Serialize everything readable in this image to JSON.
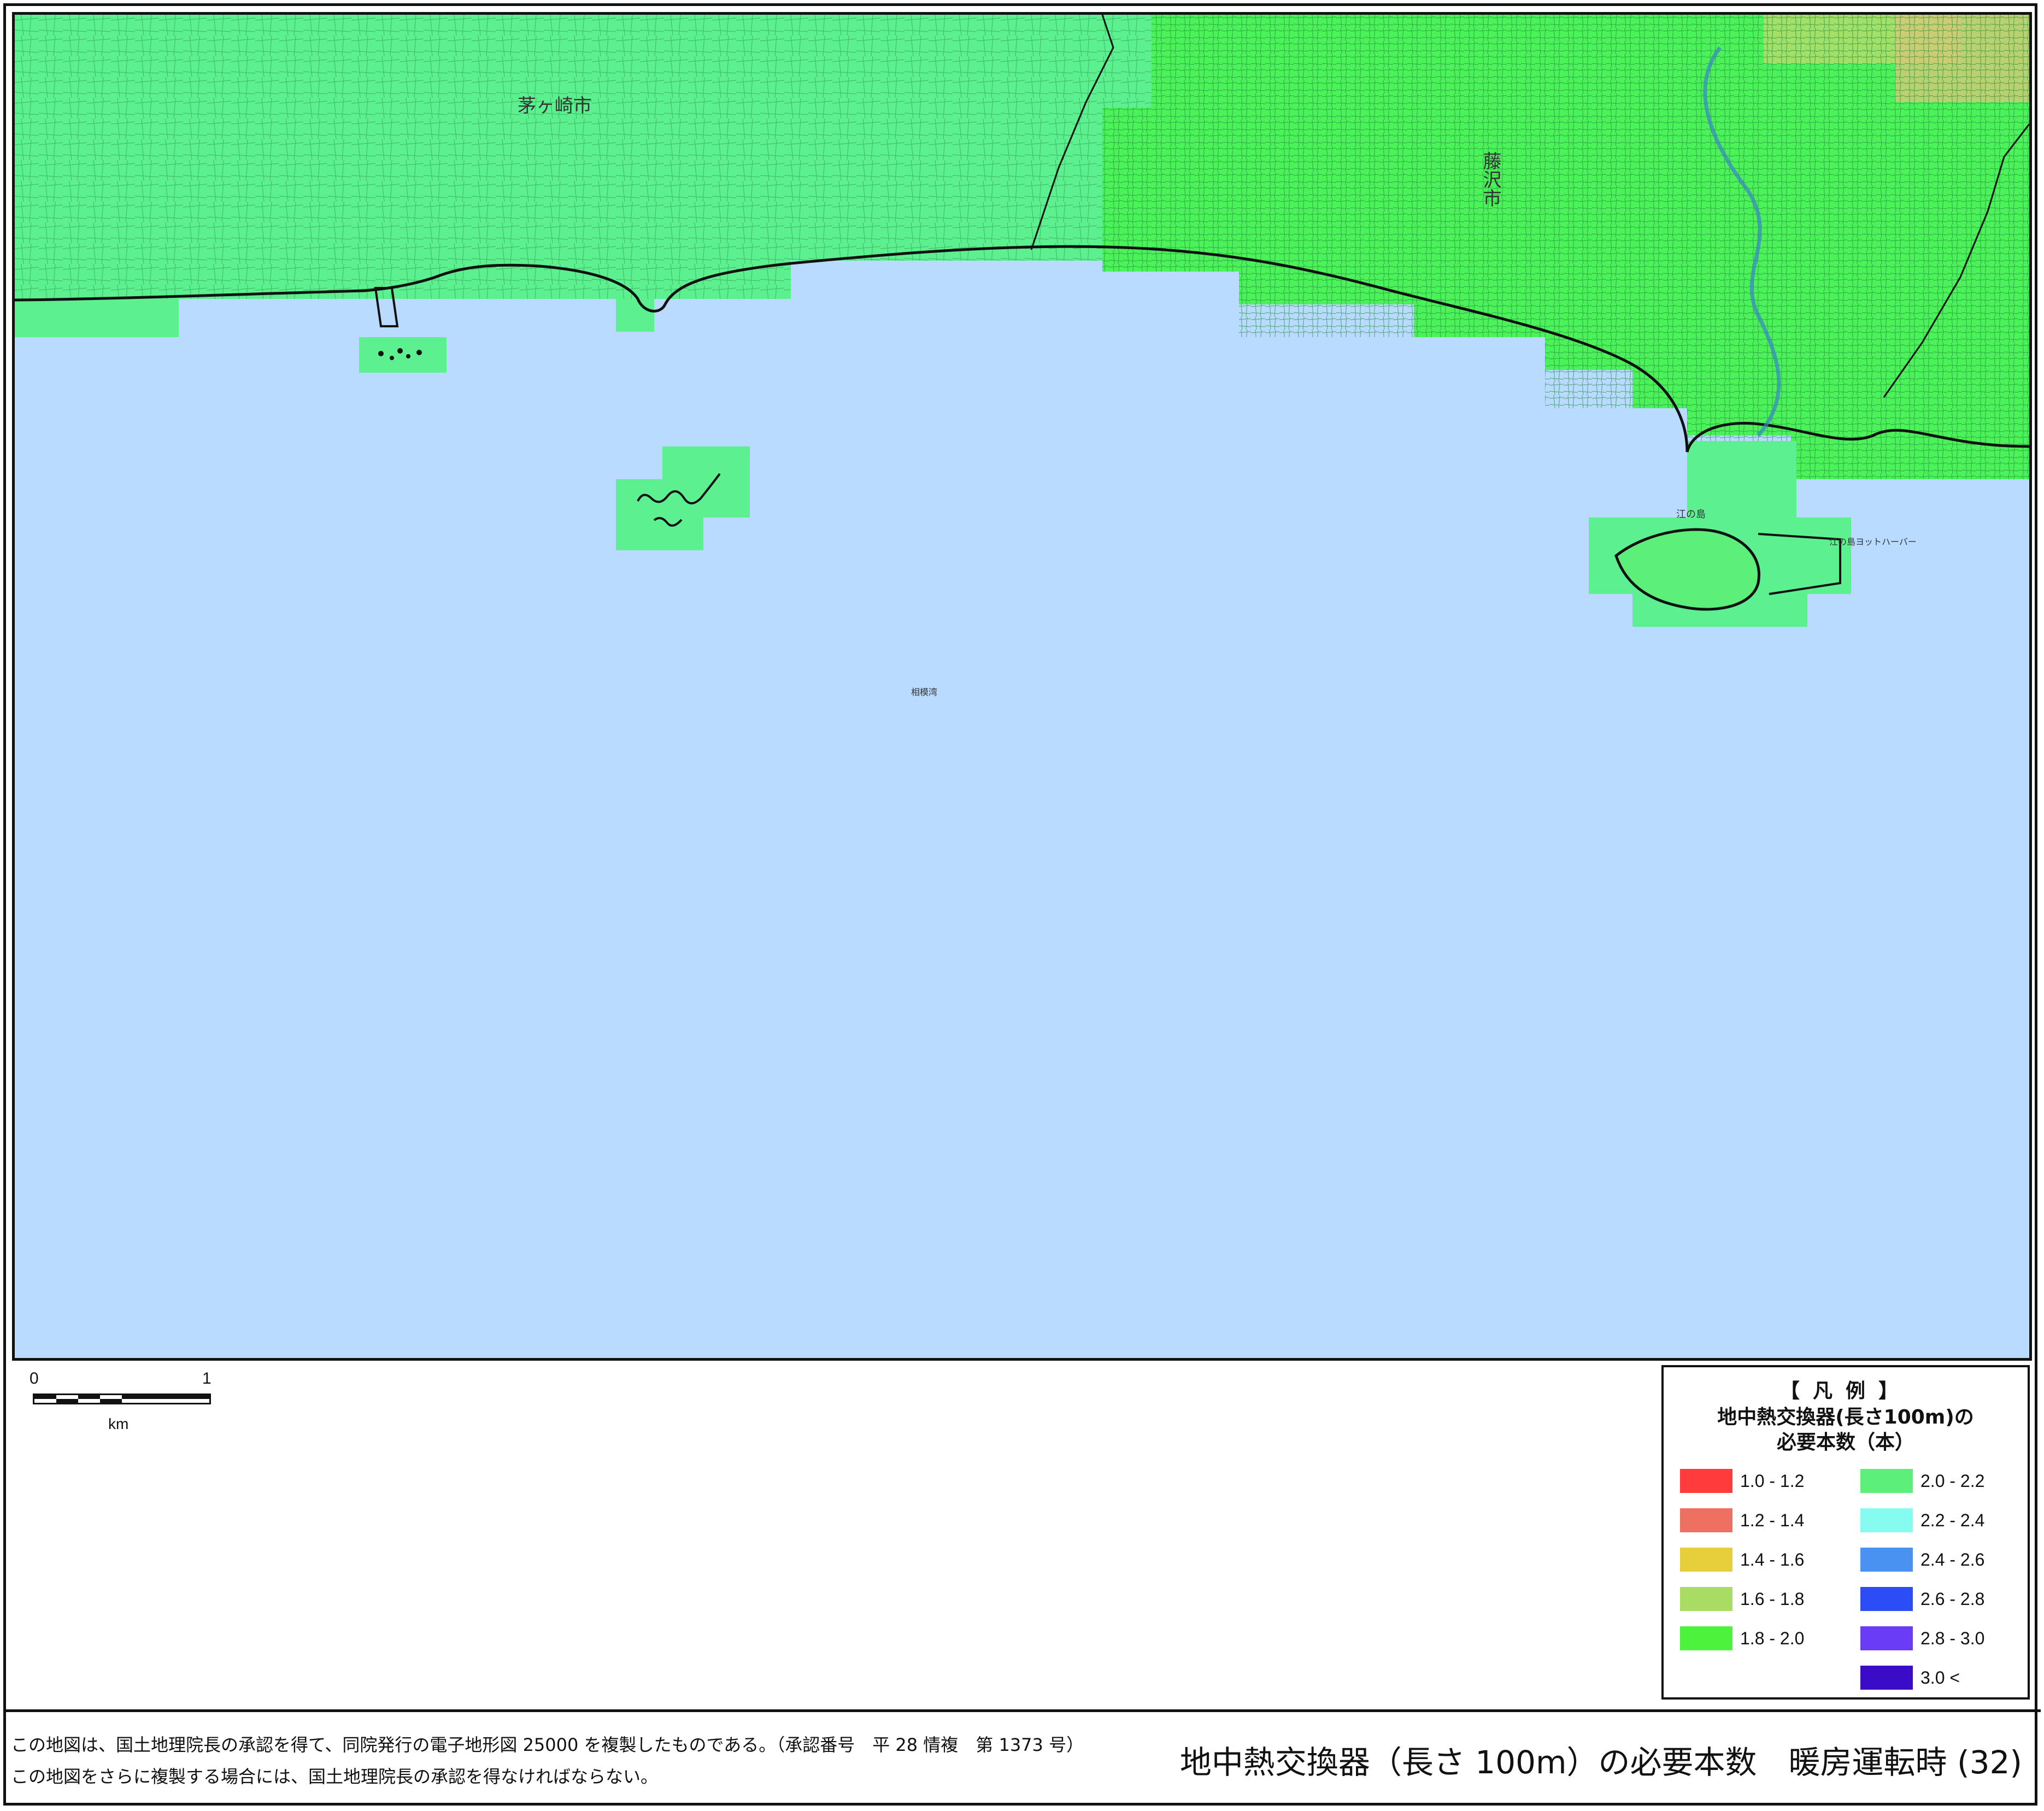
{
  "map": {
    "place_names": {
      "chigasaki": "茅ヶ崎市",
      "fujisawa": "藤沢市",
      "enoshima": "江の島",
      "sagami_bay": "相模湾",
      "yacht_harbor": "江の島ヨットハーバー"
    },
    "colors": {
      "sea": "#b8dbff",
      "land_2_0_2_2": "#5cf090",
      "land_1_8_2_0": "#4cf25a",
      "boundary": "#111111"
    }
  },
  "scale_bar": {
    "tick_start": "0",
    "tick_end": "1",
    "unit": "km"
  },
  "legend": {
    "heading": "【凡例】",
    "title_line1": "地中熱交換器(長さ100m)の",
    "title_line2": "必要本数（本）",
    "items": [
      {
        "label": "1.0 - 1.2",
        "color": "#ff3b3b"
      },
      {
        "label": "1.2 - 1.4",
        "color": "#ee7060"
      },
      {
        "label": "1.4 - 1.6",
        "color": "#e6cf3a"
      },
      {
        "label": "1.6 - 1.8",
        "color": "#a8dc62"
      },
      {
        "label": "1.8 - 2.0",
        "color": "#4cf23c"
      },
      {
        "label": "2.0 - 2.2",
        "color": "#5cf07a"
      },
      {
        "label": "2.2 - 2.4",
        "color": "#86fbf0"
      },
      {
        "label": "2.4 - 2.6",
        "color": "#4a92f2"
      },
      {
        "label": "2.6 - 2.8",
        "color": "#2c4cf6"
      },
      {
        "label": "2.8 - 3.0",
        "color": "#6a3cf6"
      },
      {
        "label": "3.0 <",
        "color": "#3a0cc8"
      }
    ]
  },
  "footer": {
    "notice_line1": "この地図は、国土地理院長の承認を得て、同院発行の電子地形図 25000 を複製したものである。（承認番号　平 28 情複　第 1373 号）",
    "notice_line2": "この地図をさらに複製する場合には、国土地理院長の承認を得なければならない。",
    "title": "地中熱交換器（長さ 100m）の必要本数　暖房運転時 (32)"
  }
}
